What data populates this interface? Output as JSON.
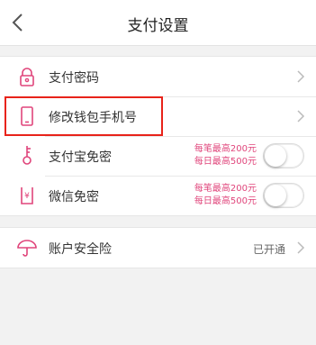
{
  "header": {
    "title": "支付设置",
    "back_icon": "chevron-left-icon"
  },
  "security_group": {
    "items": [
      {
        "label": "支付密码",
        "icon": "lock-icon"
      },
      {
        "label": "修改钱包手机号",
        "icon": "phone-icon"
      },
      {
        "label": "支付宝免密",
        "icon": "key-icon",
        "limit_per_txn": "每笔最高200元",
        "limit_per_day": "每日最高500元",
        "enabled": false
      },
      {
        "label": "微信免密",
        "icon": "yen-document-icon",
        "limit_per_txn": "每笔最高200元",
        "limit_per_day": "每日最高500元",
        "enabled": false
      }
    ]
  },
  "insurance_group": {
    "label": "账户安全险",
    "icon": "umbrella-icon",
    "status": "已开通"
  },
  "colors": {
    "accent": "#e0457b",
    "highlight": "#e8231a",
    "background": "#f2f2f2"
  }
}
